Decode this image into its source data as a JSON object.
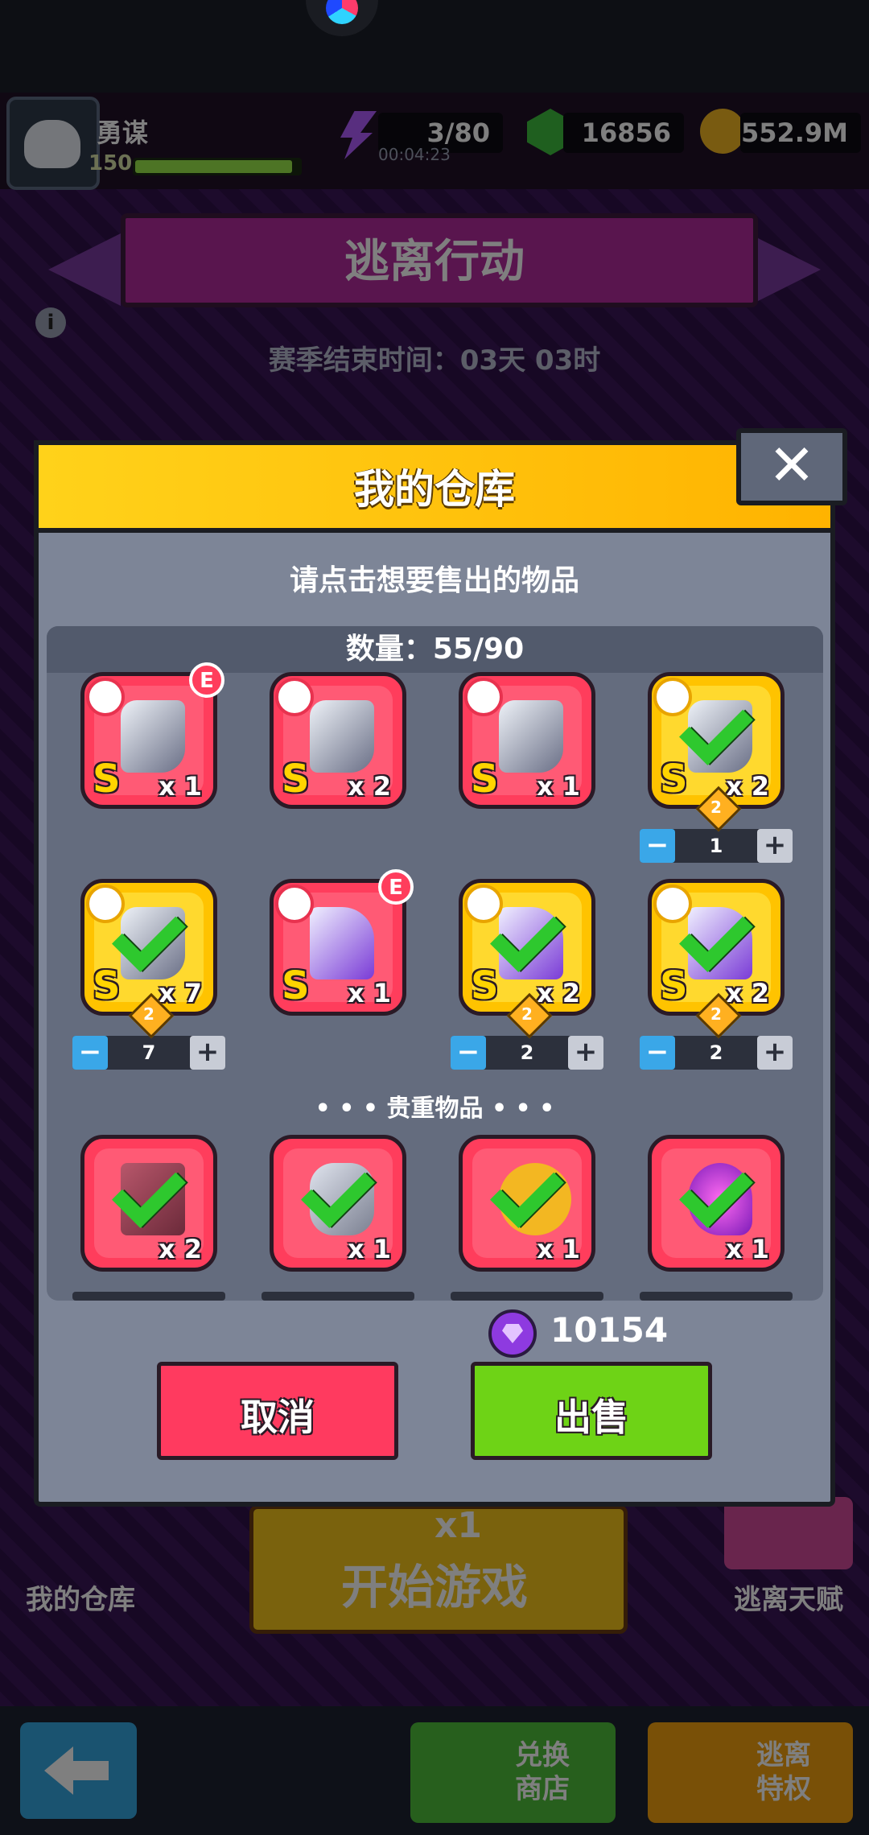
{
  "player": {
    "name": "勇谋",
    "level": "150",
    "xp_fraction": 0.95
  },
  "resources": {
    "energy": "3/80",
    "energy_timer": "00:04:23",
    "gems": "16856",
    "coins": "552.9M"
  },
  "event": {
    "title": "逃离行动",
    "season_end": "赛季结束时间：03天 03时"
  },
  "background_buttons": {
    "warehouse": "我的仓库",
    "start_cost": "x1",
    "start": "开始游戏",
    "talent": "逃离天赋",
    "shop_line1": "兑换",
    "shop_line2": "商店",
    "priv_line1": "逃离",
    "priv_line2": "特权"
  },
  "modal": {
    "title": "我的仓库",
    "close_icon": "close-icon",
    "subtitle": "请点击想要售出的物品",
    "count_label": "数量：55/90",
    "section_precious": "• • • 贵重物品 • • •",
    "gem_total": "10154",
    "cancel_label": "取消",
    "sell_label": "出售",
    "items": [
      {
        "kind": "gauntlet",
        "rarity": "S",
        "qty": "x 1",
        "gold": false,
        "badge": "E",
        "checked": false
      },
      {
        "kind": "gauntlet",
        "rarity": "S",
        "qty": "x 2",
        "gold": false,
        "badge": "",
        "checked": false
      },
      {
        "kind": "gauntlet",
        "rarity": "S",
        "qty": "x 1",
        "gold": false,
        "badge": "",
        "checked": false
      },
      {
        "kind": "gauntlet",
        "rarity": "S",
        "qty": "x 2",
        "gold": true,
        "badge": "",
        "checked": true,
        "tier": "2",
        "stepper": "1"
      },
      {
        "kind": "gauntlet",
        "rarity": "S",
        "qty": "x 7",
        "gold": true,
        "badge": "",
        "checked": true,
        "tier": "2",
        "stepper": "7"
      },
      {
        "kind": "boots",
        "rarity": "S",
        "qty": "x 1",
        "gold": false,
        "badge": "E",
        "checked": false
      },
      {
        "kind": "boots",
        "rarity": "S",
        "qty": "x 2",
        "gold": true,
        "badge": "",
        "checked": true,
        "tier": "2",
        "stepper": "2"
      },
      {
        "kind": "boots",
        "rarity": "S",
        "qty": "x 2",
        "gold": true,
        "badge": "",
        "checked": true,
        "tier": "2",
        "stepper": "2"
      }
    ],
    "precious_items": [
      {
        "kind": "book",
        "qty": "x 2",
        "checked": true
      },
      {
        "kind": "canister",
        "qty": "x 1",
        "checked": true
      },
      {
        "kind": "coin",
        "qty": "x 1",
        "checked": true
      },
      {
        "kind": "flower",
        "qty": "x 1",
        "checked": true
      }
    ]
  }
}
